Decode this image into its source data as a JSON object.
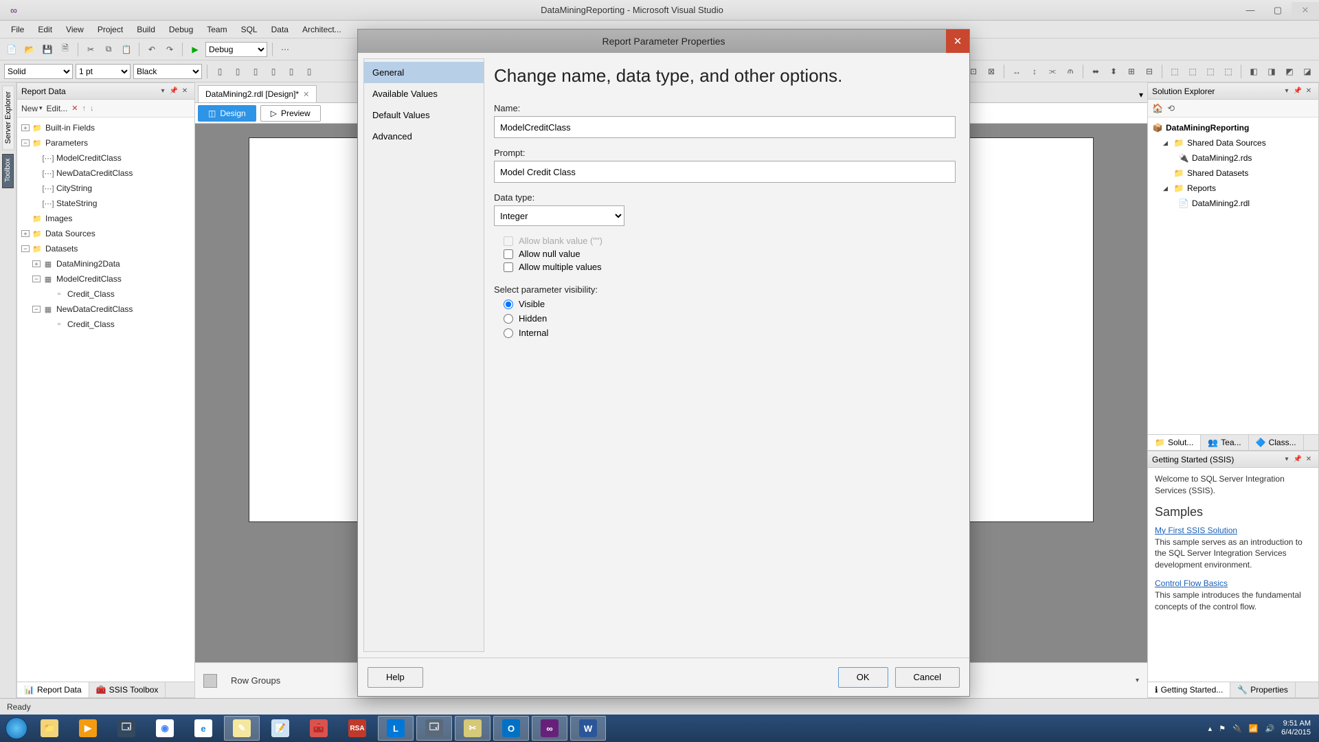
{
  "titlebar": {
    "title": "DataMiningReporting - Microsoft Visual Studio"
  },
  "menu": [
    "File",
    "Edit",
    "View",
    "Project",
    "Build",
    "Debug",
    "Team",
    "SQL",
    "Data",
    "Architect..."
  ],
  "toolbar1": {
    "config": "Debug"
  },
  "toolbar2": {
    "lineStyle": "Solid",
    "lineWeight": "1 pt",
    "color": "Black"
  },
  "reportData": {
    "title": "Report Data",
    "newBtn": "New",
    "editBtn": "Edit...",
    "builtins": "Built-in Fields",
    "parameters": "Parameters",
    "param1": "ModelCreditClass",
    "param2": "NewDataCreditClass",
    "param3": "CityString",
    "param4": "StateString",
    "images": "Images",
    "dataSources": "Data Sources",
    "datasets": "Datasets",
    "ds1": "DataMining2Data",
    "ds2": "ModelCreditClass",
    "ds2f1": "Credit_Class",
    "ds3": "NewDataCreditClass",
    "ds3f1": "Credit_Class",
    "tab1": "Report Data",
    "tab2": "SSIS Toolbox"
  },
  "leftTabs": {
    "serverExplorer": "Server Explorer",
    "toolbox": "Toolbox"
  },
  "docTab": {
    "name": "DataMining2.rdl [Design]*"
  },
  "designTabs": {
    "design": "Design",
    "preview": "Preview"
  },
  "rowGroups": "Row Groups",
  "solution": {
    "title": "Solution Explorer",
    "root": "DataMiningReporting",
    "sds": "Shared Data Sources",
    "sds1": "DataMining2.rds",
    "sdatasets": "Shared Datasets",
    "reports": "Reports",
    "rep1": "DataMining2.rdl",
    "tab1": "Solut...",
    "tab2": "Tea...",
    "tab3": "Class..."
  },
  "gs": {
    "title": "Getting Started (SSIS)",
    "intro": "Welcome to SQL Server Integration Services (SSIS).",
    "samplesHdr": "Samples",
    "link1": "My First SSIS Solution",
    "p1": "This sample serves as an introduction to the SQL Server Integration Services development environment.",
    "link2": "Control Flow Basics",
    "p2": "This sample introduces the fundamental concepts of the control flow.",
    "tab1": "Getting Started...",
    "tab2": "Properties"
  },
  "status": "Ready",
  "tray": {
    "time": "9:51 AM",
    "date": "6/4/2015"
  },
  "dialog": {
    "title": "Report Parameter Properties",
    "nav": {
      "general": "General",
      "available": "Available Values",
      "defaults": "Default Values",
      "advanced": "Advanced"
    },
    "heading": "Change name, data type, and other options.",
    "nameLabel": "Name:",
    "nameValue": "ModelCreditClass",
    "promptLabel": "Prompt:",
    "promptValue": "Model Credit Class",
    "dataTypeLabel": "Data type:",
    "dataTypeValue": "Integer",
    "allowBlank": "Allow blank value (\"\")",
    "allowNull": "Allow null value",
    "allowMulti": "Allow multiple values",
    "visLabel": "Select parameter visibility:",
    "visVisible": "Visible",
    "visHidden": "Hidden",
    "visInternal": "Internal",
    "help": "Help",
    "ok": "OK",
    "cancel": "Cancel"
  }
}
